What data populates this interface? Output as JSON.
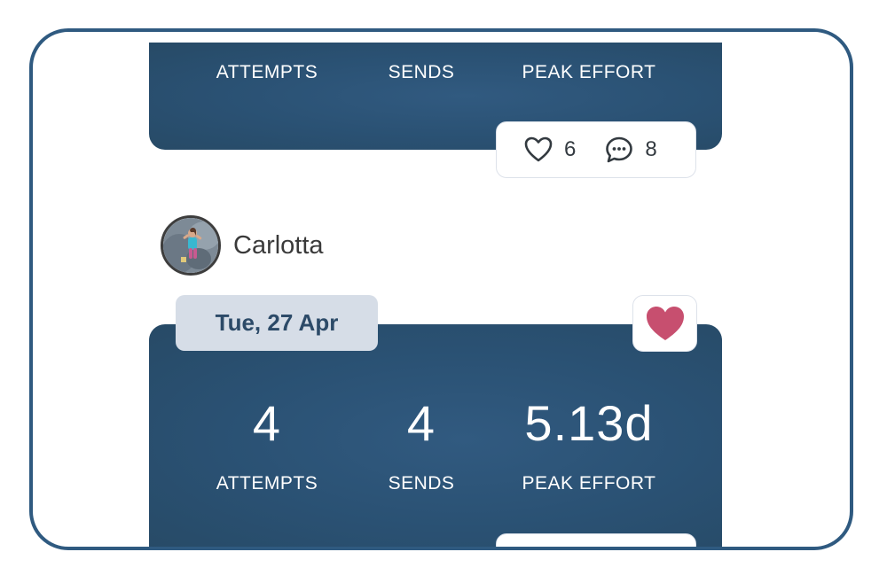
{
  "top_card": {
    "stats": [
      {
        "label": "ATTEMPTS"
      },
      {
        "label": "SENDS"
      },
      {
        "label": "PEAK EFFORT"
      }
    ],
    "reactions": {
      "likes": "6",
      "comments": "8"
    }
  },
  "post": {
    "user": {
      "name": "Carlotta"
    },
    "date": "Tue, 27 Apr",
    "favorited": true,
    "stats": [
      {
        "value": "4",
        "label": "ATTEMPTS"
      },
      {
        "value": "4",
        "label": "SENDS"
      },
      {
        "value": "5.13d",
        "label": "PEAK EFFORT"
      }
    ]
  },
  "colors": {
    "frame_border": "#2f5a80",
    "card_bg": "#2a5173",
    "heart_fill": "#c74f6f",
    "date_badge_bg": "#d6dde7"
  },
  "icons": [
    "heart-outline-icon",
    "comment-bubble-icon",
    "heart-filled-icon"
  ]
}
